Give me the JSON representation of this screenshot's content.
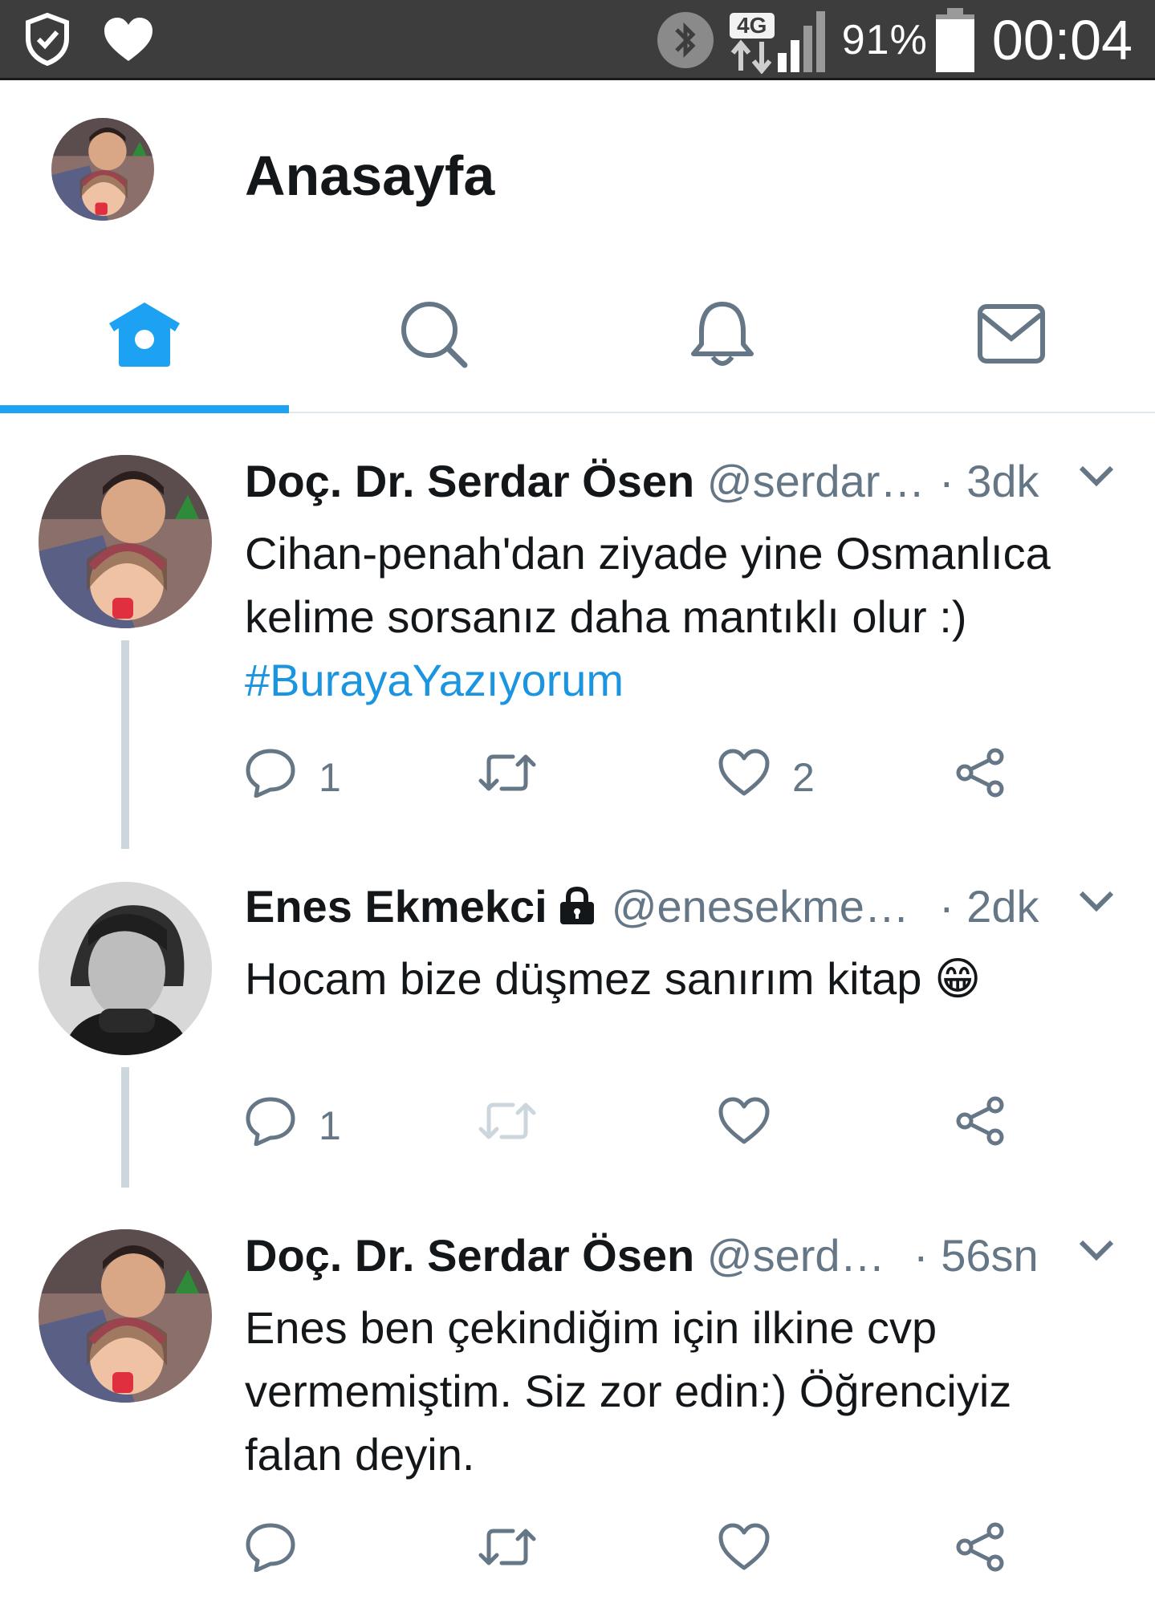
{
  "status_bar": {
    "network": "4G",
    "battery_percent": "91%",
    "time": "00:04"
  },
  "header": {
    "title": "Anasayfa"
  },
  "tabs": [
    {
      "name": "home",
      "icon": "home-icon",
      "active": true
    },
    {
      "name": "search",
      "icon": "search-icon",
      "active": false
    },
    {
      "name": "notifications",
      "icon": "bell-icon",
      "active": false
    },
    {
      "name": "messages",
      "icon": "mail-icon",
      "active": false
    }
  ],
  "colors": {
    "accent": "#1da1f2",
    "hashtag": "#1b95e0",
    "muted": "#657786",
    "status_bar": "#3d3d3d",
    "thread_line": "#ccd6dd"
  },
  "tweets": [
    {
      "name": "Doç. Dr. Serdar Ösen",
      "handle": "@serdar…",
      "time": "· 3dk",
      "text_lines": [
        "Cihan-penah'dan ziyade yine Osmanlıca",
        "kelime  sorsanız daha mantıklı olur :)"
      ],
      "hashtag": "#BurayaYazıyorum",
      "replies": "1",
      "likes": "2"
    },
    {
      "name": "Enes Ekmekci",
      "handle": "@enesekme…",
      "time": "· 2dk",
      "text_lines": [
        "Hocam bize düşmez sanırım kitap 😁"
      ],
      "replies": "1",
      "protected": true
    },
    {
      "name": "Doç. Dr. Serdar Ösen",
      "handle": "@serd…",
      "time": "· 56sn",
      "text_lines": [
        "Enes ben çekindiğim için ilkine cvp",
        "vermemiştim. Siz zor edin:) Öğrenciyiz",
        "falan deyin."
      ]
    }
  ]
}
